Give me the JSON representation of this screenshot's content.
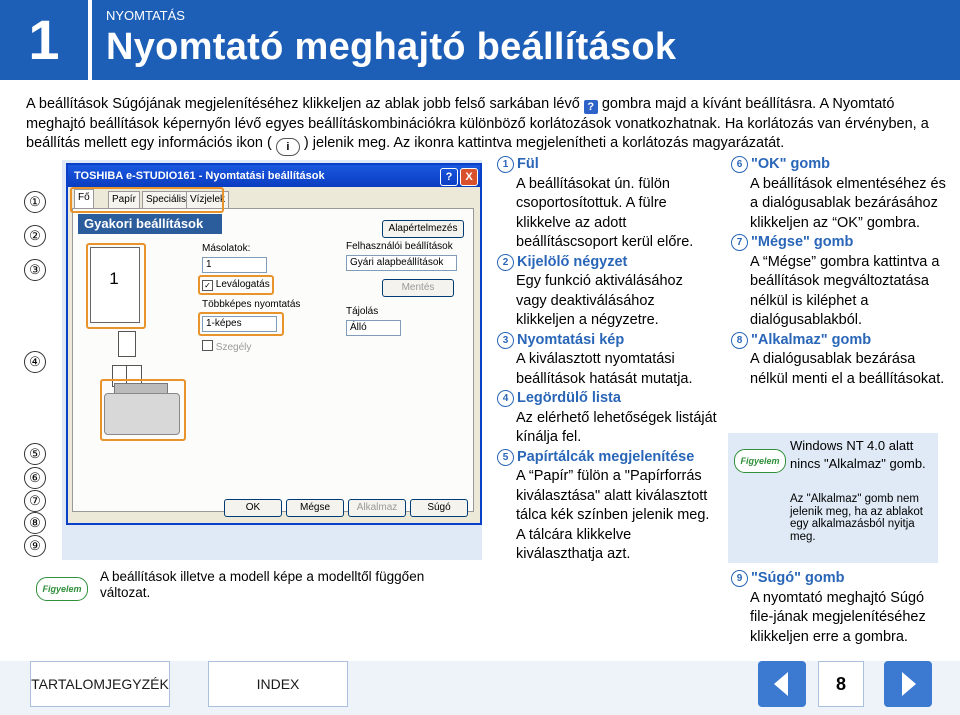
{
  "header": {
    "chapter_number": "1",
    "section_label": "NYOMTATÁS",
    "title": "Nyomtató meghajtó beállítások"
  },
  "intro": {
    "part1": "A beállítások Súgójának megjelenítéséhez klikkeljen az ablak jobb felső sarkában lévő",
    "help_icon": "?",
    "part2": "gombra majd a kívánt beállításra. A Nyomtató meghajtó beállítások képernyőn lévő egyes beállításkombinációkra különböző korlátozások vonatkozhatnak. Ha korlátozás van érvényben, a beállítás mellett egy információs ikon (",
    "info_icon": "i",
    "part3": ") jelenik meg. Az ikonra kattintva megjelenítheti a korlátozás magyarázatát."
  },
  "callouts": [
    "①",
    "②",
    "③",
    "④",
    "⑤",
    "⑥",
    "⑦",
    "⑧",
    "⑨"
  ],
  "dialog": {
    "title": "TOSHIBA e-STUDIO161 - Nyomtatási beállítások",
    "help_btn": "?",
    "close_btn": "X",
    "tabs": [
      "Fő",
      "Papír",
      "Speciális",
      "Vízjelek"
    ],
    "section_header": "Gyakori beállítások",
    "preview_number": "1",
    "copies_label": "Másolatok:",
    "copies_value": "1",
    "collate_label": "Leválogatás",
    "nup_label": "Többképes nyomtatás",
    "nup_value": "1-képes",
    "border_label": "Szegély",
    "alapertek_btn": "Alapértelmezés",
    "user_settings_label": "Felhasználói beállítások",
    "user_settings_value": "Gyári alapbeállítások",
    "save_btn": "Mentés",
    "orientation_label": "Tájolás",
    "orientation_value": "Álló",
    "ok_btn": "OK",
    "cancel_btn": "Mégse",
    "apply_btn": "Alkalmaz",
    "help_btn2": "Súgó"
  },
  "panel_note": "A beállítások illetve a modell képe a modelltől függően változat.",
  "figyelem_label": "Figyelem",
  "items_col1": [
    {
      "num": "1",
      "head": "Fül",
      "desc": "A beállításokat ún. fülön csoportosítottuk. A fülre klikkelve az adott beállításcsoport kerül előre."
    },
    {
      "num": "2",
      "head": "Kijelölő négyzet",
      "desc": "Egy funkció aktiválásához vagy deaktiválásához klikkeljen a négyzetre."
    },
    {
      "num": "3",
      "head": "Nyomtatási kép",
      "desc": "A kiválasztott nyomtatási beállítások hatását mutatja."
    },
    {
      "num": "4",
      "head": "Legördülő lista",
      "desc": "Az elérhető lehetőségek listáját kínálja fel."
    },
    {
      "num": "5",
      "head": "Papírtálcák megjelenítése",
      "desc": "A “Papír” fülön a \"Papírforrás kiválasztása\" alatt kiválasztott tálca kék színben jelenik meg. A tálcára klikkelve kiválaszthatja azt."
    }
  ],
  "items_col2": [
    {
      "num": "6",
      "head": "\"OK\" gomb",
      "desc": "A beállítások elmentéséhez és a dialógusablak bezárásához klikkeljen az “OK” gombra."
    },
    {
      "num": "7",
      "head": "\"Mégse\" gomb",
      "desc": "A “Mégse” gombra kattintva a beállítások megváltoztatása nélkül is kiléphet a dialógusablakból."
    },
    {
      "num": "8",
      "head": "\"Alkalmaz\" gomb",
      "desc": "A dialógusablak bezárása nélkül menti el a beállításokat."
    }
  ],
  "note": {
    "line1": "Windows NT 4.0 alatt nincs \"Alkalmaz\" gomb.",
    "line2": "Az \"Alkalmaz\" gomb nem jelenik meg, ha az ablakot egy alkalmazásból nyitja meg."
  },
  "item9": {
    "num": "9",
    "head": "\"Súgó\" gomb",
    "desc": "A nyomtató meghajtó Súgó file-jának megjelenítéséhez klikkeljen erre a gombra."
  },
  "footer": {
    "toc_label": "TARTALOMJEGYZÉK",
    "index_label": "INDEX",
    "page_number": "8"
  }
}
